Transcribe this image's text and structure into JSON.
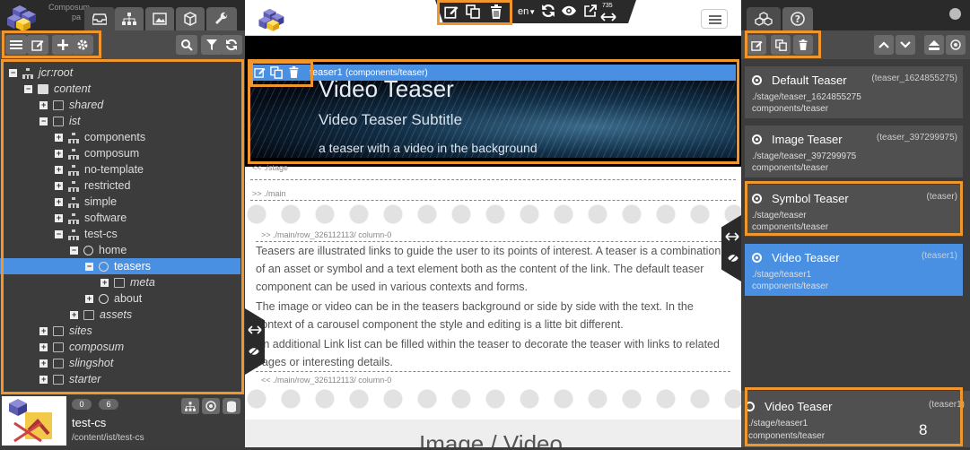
{
  "left": {
    "tabs": {
      "composum_label": "Composum",
      "pages_label": "pa"
    },
    "tree": [
      {
        "label": "jcr:root",
        "italic": true,
        "level": 0,
        "pm": "−",
        "icon": "tree"
      },
      {
        "label": "content",
        "italic": true,
        "level": 1,
        "pm": "−",
        "icon": "folder-fill"
      },
      {
        "label": "shared",
        "italic": true,
        "level": 2,
        "pm": "+",
        "icon": "folder"
      },
      {
        "label": "ist",
        "italic": true,
        "level": 2,
        "pm": "−",
        "icon": "folder"
      },
      {
        "label": "components",
        "italic": false,
        "level": 3,
        "pm": "+",
        "icon": "tree"
      },
      {
        "label": "composum",
        "italic": false,
        "level": 3,
        "pm": "+",
        "icon": "tree"
      },
      {
        "label": "no-template",
        "italic": false,
        "level": 3,
        "pm": "+",
        "icon": "tree"
      },
      {
        "label": "restricted",
        "italic": false,
        "level": 3,
        "pm": "+",
        "icon": "tree"
      },
      {
        "label": "simple",
        "italic": false,
        "level": 3,
        "pm": "+",
        "icon": "tree"
      },
      {
        "label": "software",
        "italic": false,
        "level": 3,
        "pm": "+",
        "icon": "tree"
      },
      {
        "label": "test-cs",
        "italic": false,
        "level": 3,
        "pm": "−",
        "icon": "tree"
      },
      {
        "label": "home",
        "italic": false,
        "level": 4,
        "pm": "−",
        "icon": "globe"
      },
      {
        "label": "teasers",
        "italic": false,
        "level": 5,
        "pm": "−",
        "icon": "globe",
        "selected": true
      },
      {
        "label": "meta",
        "italic": true,
        "level": 6,
        "pm": "+",
        "icon": "folder"
      },
      {
        "label": "about",
        "italic": false,
        "level": 5,
        "pm": "+",
        "icon": "globe"
      },
      {
        "label": "assets",
        "italic": true,
        "level": 4,
        "pm": "+",
        "icon": "folder"
      },
      {
        "label": "sites",
        "italic": true,
        "level": 2,
        "pm": "+",
        "icon": "folder"
      },
      {
        "label": "composum",
        "italic": true,
        "level": 2,
        "pm": "+",
        "icon": "folder"
      },
      {
        "label": "slingshot",
        "italic": true,
        "level": 2,
        "pm": "+",
        "icon": "folder"
      },
      {
        "label": "starter",
        "italic": true,
        "level": 2,
        "pm": "+",
        "icon": "folder"
      }
    ],
    "site": {
      "badge1": "0",
      "badge2": "6",
      "name": "test-cs",
      "path": "/content/ist/test-cs"
    }
  },
  "center": {
    "language": "en",
    "width_label": "735",
    "stage_component": "teaser1",
    "stage_type": "(components/teaser)",
    "teaser_title": "Video Teaser",
    "teaser_subtitle": "Video Teaser Subtitle",
    "teaser_text": "a teaser with a video in the background",
    "crumb_stage": "<< ./stage",
    "crumb_main": ">> ./main",
    "crumb_column_open": ">> ./main/row_326112113/ column-0",
    "para1": "Teasers are illustrated links to guide the user to its points of interest. A teaser is a combination of an asset or symbol and a text element both as the content of the link. The default teaser component can be used in various contexts and forms.",
    "para2": "The image or video can be in the teasers background or side by side with the text. In the context of a carousel component the style and editing is a litte bit different.",
    "para3": "An additional Link list can be filled within the teaser to decorate the teaser with links to related pages or interesting details.",
    "crumb_column_close": "<< ./main/row_326112113/ column-0",
    "next_heading": "Image / Video"
  },
  "right": {
    "cards": [
      {
        "title": "Default Teaser",
        "key": "(teaser_1624855275)",
        "path": "./stage/teaser_1624855275",
        "type": "components/teaser"
      },
      {
        "title": "Image Teaser",
        "key": "(teaser_397299975)",
        "path": "./stage/teaser_397299975",
        "type": "components/teaser"
      },
      {
        "title": "Symbol Teaser",
        "key": "(teaser)",
        "path": "./stage/teaser",
        "type": "components/teaser"
      },
      {
        "title": "Video Teaser",
        "key": "(teaser1)",
        "path": "./stage/teaser1",
        "type": "components/teaser",
        "selected": true
      }
    ],
    "drag_card": {
      "title": "Video Teaser",
      "key": "(teaser1)",
      "path": "./stage/teaser1",
      "type": "components/teaser",
      "number": "8"
    }
  },
  "colors": {
    "accent": "#4a90e2",
    "highlight": "#f0962d",
    "panel": "#3c3c3c"
  }
}
